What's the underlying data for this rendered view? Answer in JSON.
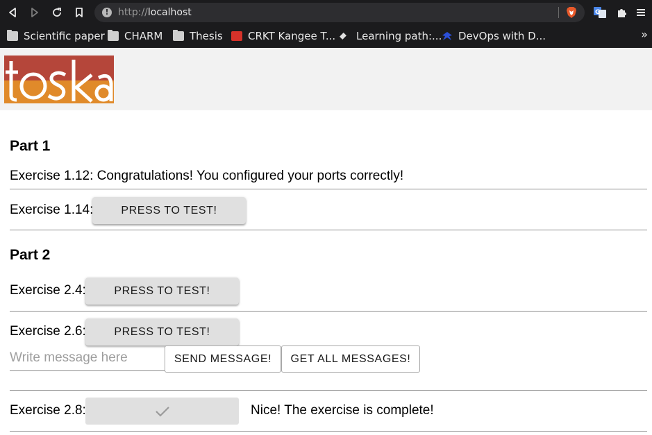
{
  "browser": {
    "url_scheme": "http://",
    "url_host": "localhost",
    "bookmarks": [
      {
        "label": "Scientific paper",
        "icon": "folder-icon"
      },
      {
        "label": "CHARM",
        "icon": "folder-icon"
      },
      {
        "label": "Thesis",
        "icon": "folder-icon"
      },
      {
        "label": "CRKT Kangee T...",
        "icon": "crkt-favicon"
      },
      {
        "label": "Learning path:...",
        "icon": "learning-favicon"
      },
      {
        "label": "DevOps with D...",
        "icon": "devops-favicon"
      }
    ],
    "more_label": "»"
  },
  "logo": {
    "text": "toska",
    "colors": [
      "#b5463a",
      "#e08a2a"
    ]
  },
  "part1": {
    "heading": "Part 1",
    "ex112": "Exercise 1.12: Congratulations! You configured your ports correctly!",
    "ex114_label": "Exercise 1.14:",
    "ex114_button": "PRESS TO TEST!"
  },
  "part2": {
    "heading": "Part 2",
    "ex24_label": "Exercise 2.4:",
    "ex24_button": "PRESS TO TEST!",
    "ex26_label": "Exercise 2.6:",
    "ex26_button": "PRESS TO TEST!",
    "message_placeholder": "Write message here",
    "send_button": "SEND MESSAGE!",
    "get_button": "GET ALL MESSAGES!",
    "ex28_label": "Exercise 2.8:",
    "ex28_status": "Nice! The exercise is complete!"
  }
}
